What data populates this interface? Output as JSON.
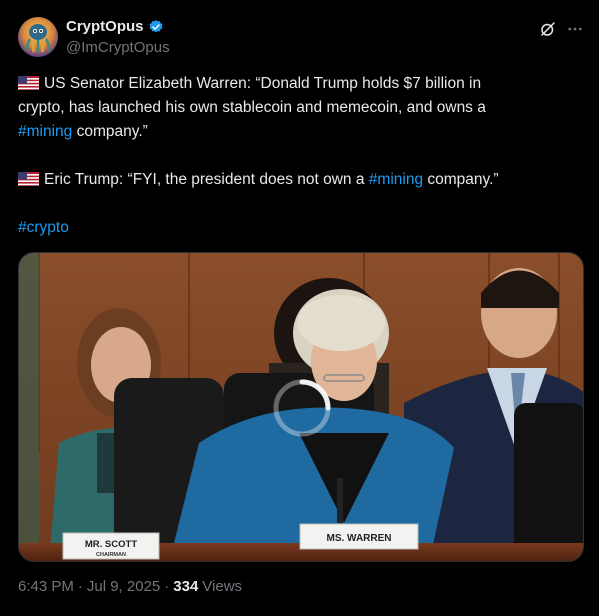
{
  "author": {
    "display_name": "CryptOpus",
    "handle": "@ImCryptOpus"
  },
  "icons": {
    "verified": "verified-badge-icon",
    "grok": "grok-icon",
    "more": "more-icon"
  },
  "tweet": {
    "line1_part1": "US Senator Elizabeth Warren: “Donald Trump holds $7 billion in",
    "line1_part2": "crypto, has launched his own stablecoin and memecoin, and owns a",
    "line1_hashtag": "#mining",
    "line1_part3": " company.”",
    "line2_part1": "Eric Trump: “FYI, the president does not own a ",
    "line2_hashtag": "#mining",
    "line2_part2": " company.”",
    "hashtag_crypto": "#crypto"
  },
  "media": {
    "nameplate_left_line1": "MR. SCOTT",
    "nameplate_left_line2": "CHAIRMAN",
    "nameplate_center": "MS. WARREN"
  },
  "meta": {
    "time": "6:43 PM",
    "separator": "·",
    "date": "Jul 9, 2025",
    "views_count": "334",
    "views_label": "Views"
  },
  "colors": {
    "background": "#000000",
    "text": "#e7e9ea",
    "secondary": "#71767b",
    "link": "#1d9bf0",
    "verified": "#1d9bf0"
  }
}
